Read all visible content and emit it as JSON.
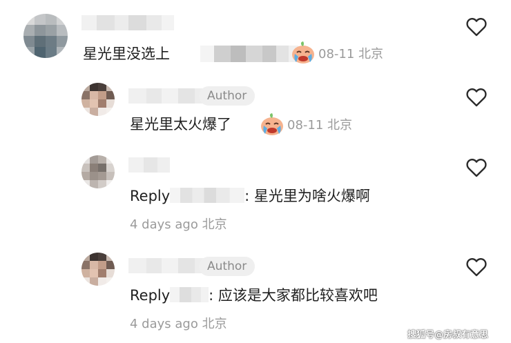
{
  "comments": [
    {
      "text": "星光里没选上",
      "date": "08-11",
      "location": "北京",
      "emoji_icon": "crying-face-icon"
    },
    {
      "badge": "Author",
      "text": "星光里太火爆了",
      "date": "08-11",
      "location": "北京",
      "emoji_icon": "crying-face-icon"
    },
    {
      "reply_prefix": "Reply",
      "text": ": 星光里为啥火爆啊",
      "date": "4 days ago",
      "location": "北京"
    },
    {
      "badge": "Author",
      "reply_prefix": "Reply",
      "text": ": 应该是大家都比较喜欢吧",
      "date": "4 days ago",
      "location": "北京"
    }
  ],
  "watermark": "搜狐号@房叔有意思",
  "colors": {
    "text": "#1f1f1f",
    "meta": "#9a9a9a",
    "badge_bg": "#efefef"
  }
}
